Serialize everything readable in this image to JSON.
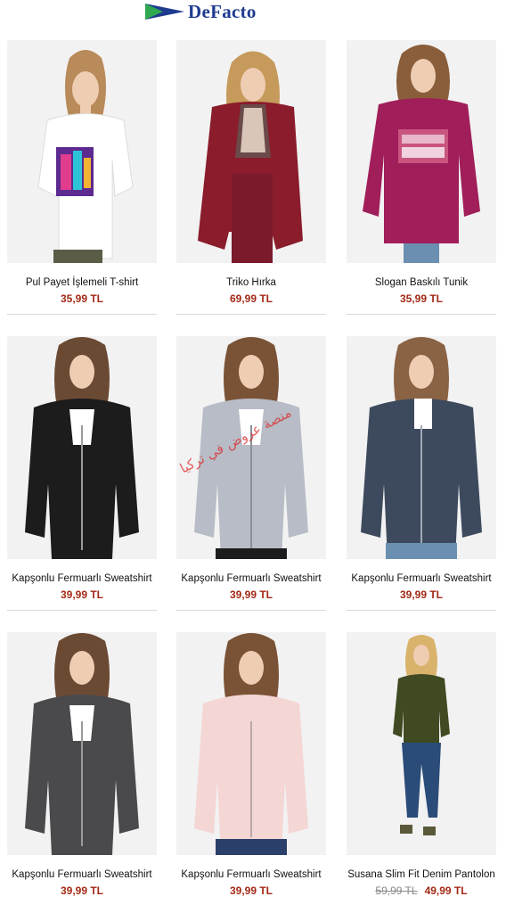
{
  "header": {
    "brand": "DeFacto",
    "logo_icon": "brand-arrow-icon",
    "colors": {
      "brand_blue": "#1f3b8f",
      "brand_green": "#2fa84f"
    }
  },
  "watermark": "منصة عروض في تركيا",
  "colors": {
    "price": "#a32a17",
    "old_price": "#888888"
  },
  "products": [
    {
      "name": "Pul Payet İşlemeli T-shirt",
      "price": "35,99 TL",
      "old_price": ""
    },
    {
      "name": "Triko Hırka",
      "price": "69,99 TL",
      "old_price": ""
    },
    {
      "name": "Slogan Baskılı Tunik",
      "price": "35,99 TL",
      "old_price": ""
    },
    {
      "name": "Kapşonlu Fermuarlı Sweatshirt",
      "price": "39,99 TL",
      "old_price": ""
    },
    {
      "name": "Kapşonlu Fermuarlı Sweatshirt",
      "price": "39,99 TL",
      "old_price": ""
    },
    {
      "name": "Kapşonlu Fermuarlı Sweatshirt",
      "price": "39,99 TL",
      "old_price": ""
    },
    {
      "name": "Kapşonlu Fermuarlı Sweatshirt",
      "price": "39,99 TL",
      "old_price": ""
    },
    {
      "name": "Kapşonlu Fermuarlı Sweatshirt",
      "price": "39,99 TL",
      "old_price": ""
    },
    {
      "name": "Susana Slim Fit Denim Pantolon",
      "price": "49,99 TL",
      "old_price": "59,99 TL"
    }
  ]
}
